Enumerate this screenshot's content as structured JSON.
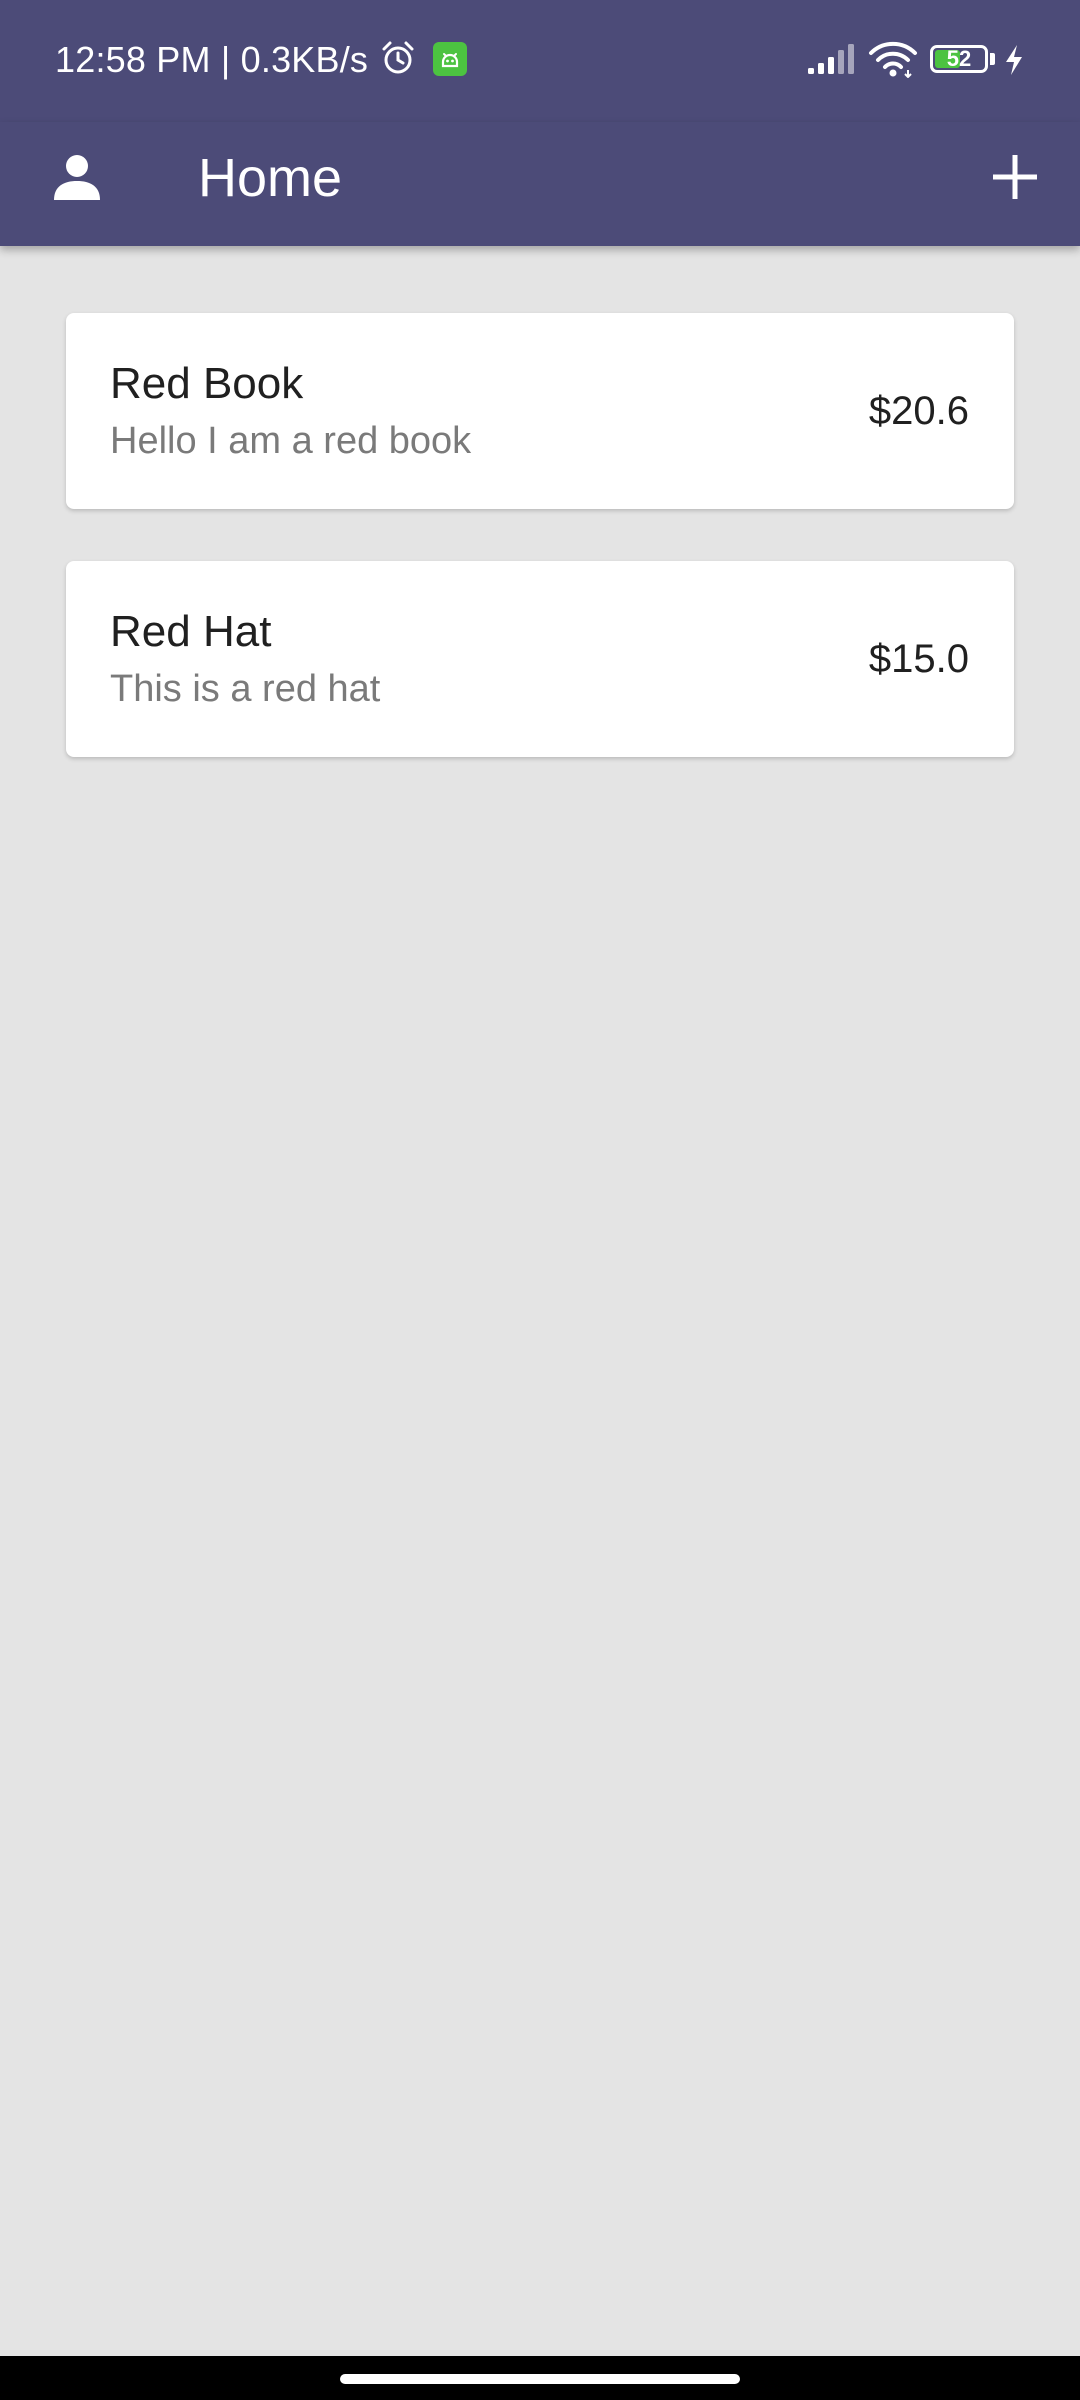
{
  "status_bar": {
    "time_network": "12:58 PM | 0.3KB/s",
    "alarm_icon": "alarm-clock-icon",
    "app_icon": "android-robot-icon",
    "signal_icon": "cellular-signal-icon",
    "wifi_icon": "wifi-icon",
    "battery_level": "52",
    "battery_fraction": 0.52,
    "charging_icon": "lightning-bolt-icon",
    "background": "#4c4b78",
    "battery_color": "#4cc341"
  },
  "app_bar": {
    "title": "Home",
    "profile_icon": "person-icon",
    "add_icon": "plus-icon",
    "background": "#4c4b78"
  },
  "products": [
    {
      "name": "Red Book",
      "description": "Hello I am a red book",
      "price": "$20.6"
    },
    {
      "name": "Red Hat",
      "description": "This is a red hat",
      "price": "$15.0"
    }
  ],
  "colors": {
    "page_background": "#e4e4e4",
    "card_background": "#ffffff",
    "primary_text": "#202020",
    "secondary_text": "#7a7a7a"
  }
}
